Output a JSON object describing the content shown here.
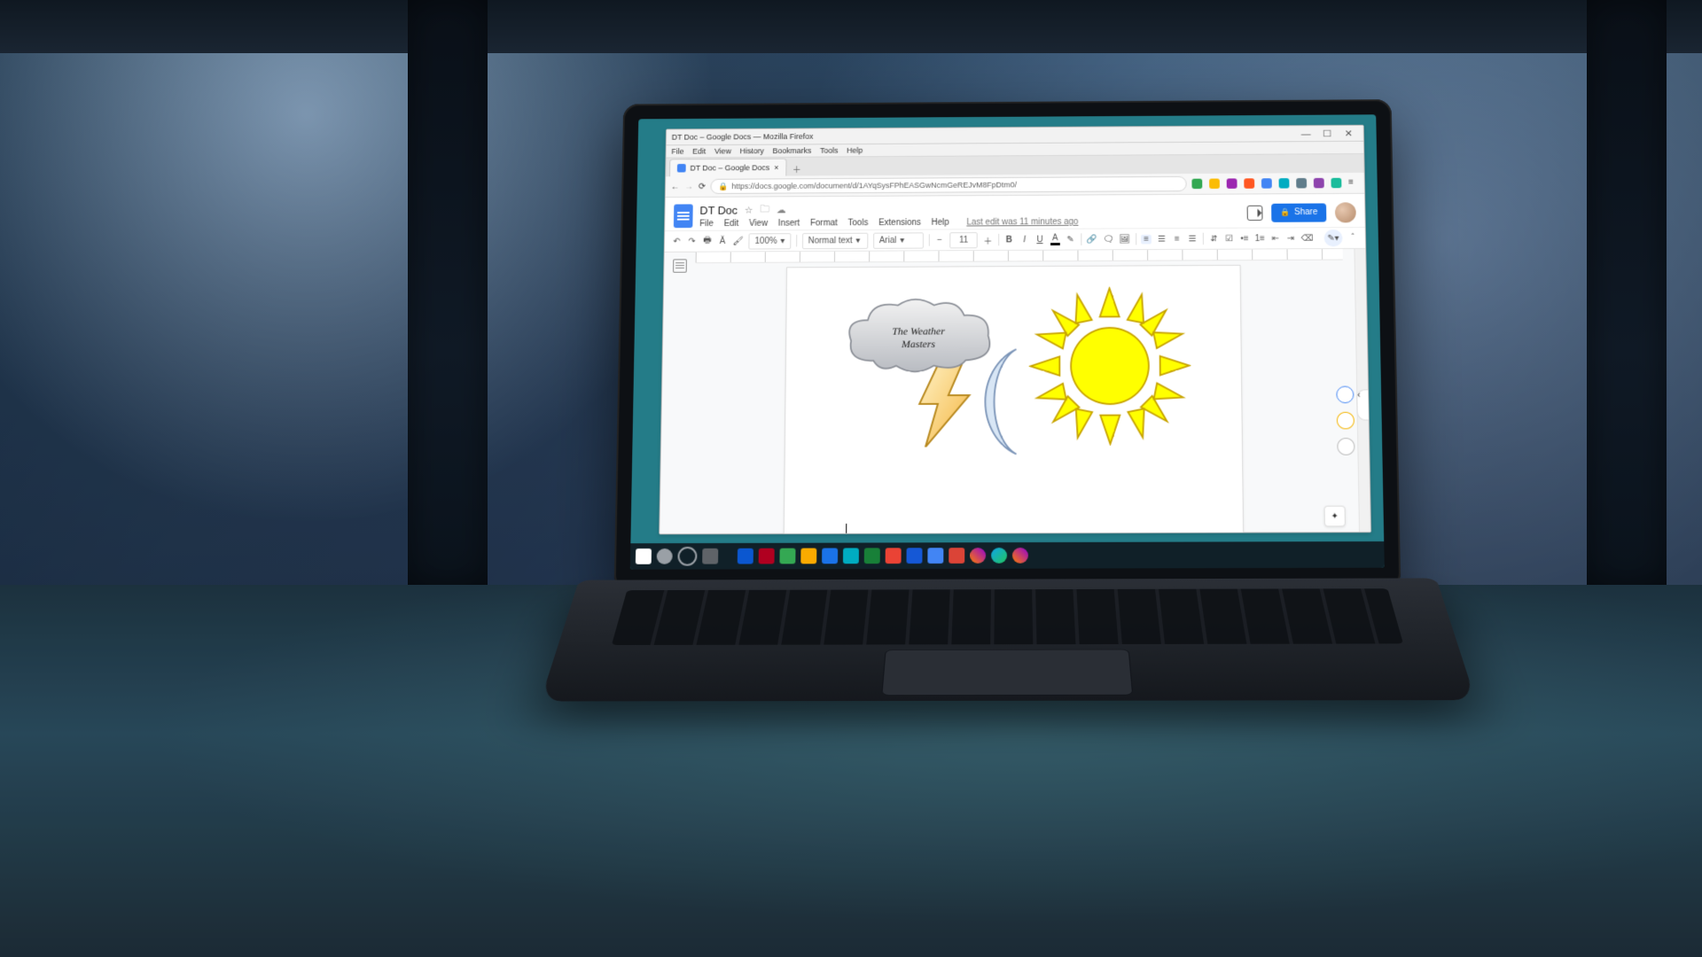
{
  "browser": {
    "window_title": "DT Doc – Google Docs — Mozilla Firefox",
    "menubar": [
      "File",
      "Edit",
      "View",
      "History",
      "Bookmarks",
      "Tools",
      "Help"
    ],
    "tab_label": "DT Doc – Google Docs",
    "url": "https://docs.google.com/document/d/1AYqSysFPhEASGwNcmGeREJvM8FpDtm0/",
    "url_prefix": "https://",
    "window_controls": {
      "min": "—",
      "max": "☐",
      "close": "✕"
    },
    "ext_colors": [
      "#33a852",
      "#fbbc05",
      "#9c27b0",
      "#ff5722",
      "#4285f4",
      "#00acc1",
      "#607d8b",
      "#8e44ad",
      "#1abc9c"
    ]
  },
  "docs": {
    "title": "DT Doc",
    "menus": [
      "File",
      "Edit",
      "View",
      "Insert",
      "Format",
      "Tools",
      "Extensions",
      "Help"
    ],
    "last_edit": "Last edit was 11 minutes ago",
    "share_label": "Share",
    "toolbar": {
      "zoom": "100%",
      "style": "Normal text",
      "font": "Arial",
      "size": "11"
    }
  },
  "drawing": {
    "cloud_text_line1": "The Weather",
    "cloud_text_line2": "Masters",
    "colors": {
      "cloud_fill": "url(#cloudGrad)",
      "cloud_stroke": "#8a8e96",
      "bolt_fill": "url(#boltGrad)",
      "bolt_stroke": "#b8891e",
      "moon_fill": "#d8e6f5",
      "moon_stroke": "#7c95b8",
      "sun_fill": "#ffff00",
      "sun_stroke": "#c8a400"
    }
  },
  "taskbar_icons": [
    "#ffffff",
    "#9aa0a6",
    "#5f6368",
    "#0b57d0",
    "#b00020",
    "#34a853",
    "#faab00",
    "#1a73e8",
    "#00acc1",
    "#188038",
    "#ea4335",
    "#1558d6",
    "#4285f4",
    "#db4437",
    "#6d28d9",
    "#ff6f00",
    "#4285f4",
    "#ff7043"
  ]
}
